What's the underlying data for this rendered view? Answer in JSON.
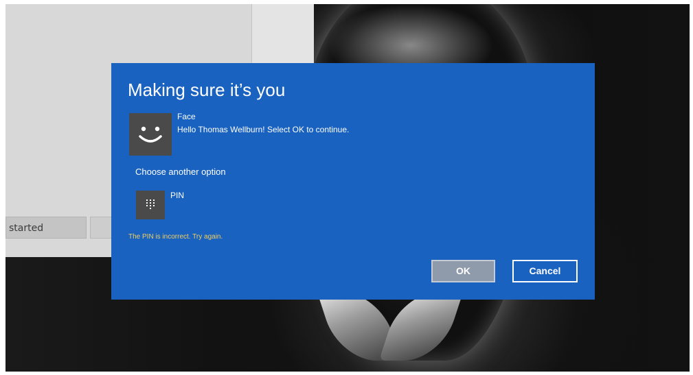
{
  "background_app": {
    "tab_label": "started"
  },
  "dialog": {
    "title": "Making sure it’s you",
    "face": {
      "icon": "smiley-face-icon",
      "label": "Face",
      "message": "Hello Thomas Wellburn! Select OK to continue."
    },
    "choose_another": "Choose another option",
    "pin": {
      "icon": "keypad-icon",
      "label": "PIN"
    },
    "error": "The PIN is incorrect. Try again.",
    "ok_label": "OK",
    "cancel_label": "Cancel"
  },
  "colors": {
    "dialog_background": "#1a62c0",
    "error_text": "#f0d060",
    "tile_background": "#4a4a4a"
  }
}
